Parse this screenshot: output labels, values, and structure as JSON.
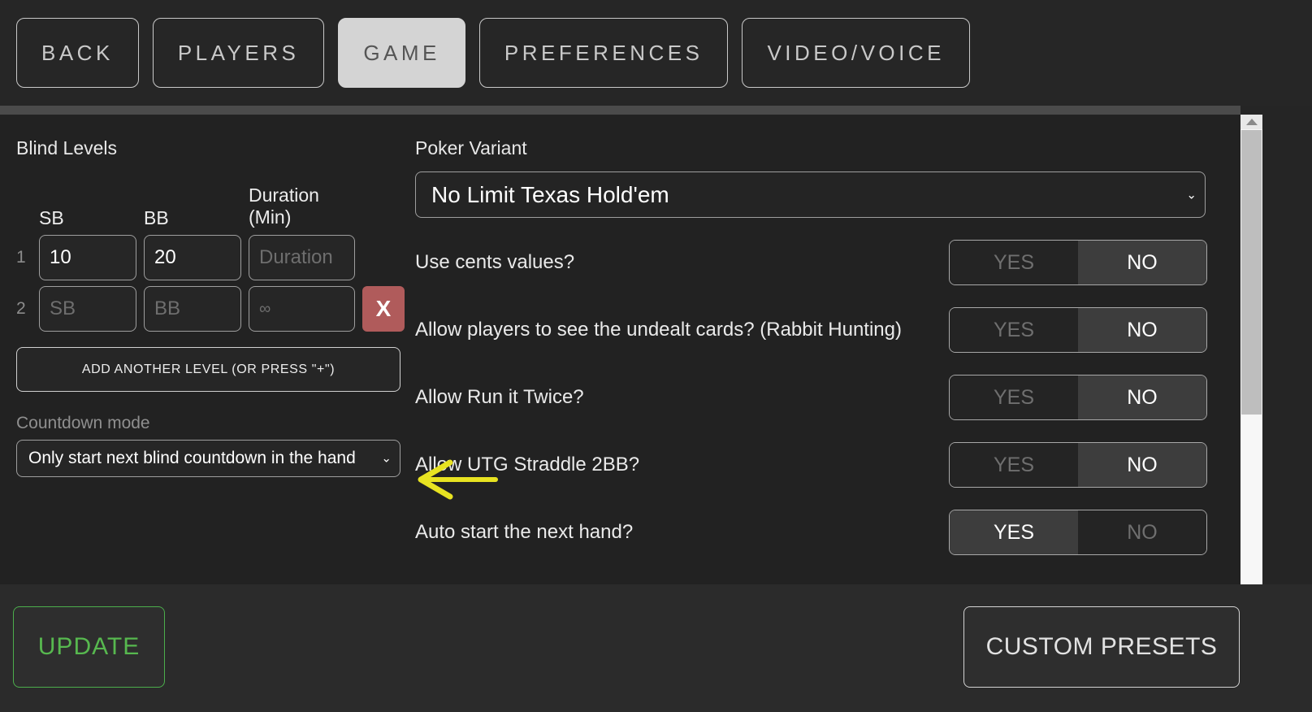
{
  "tabs": [
    {
      "label": "BACK",
      "active": false
    },
    {
      "label": "PLAYERS",
      "active": false
    },
    {
      "label": "GAME",
      "active": true
    },
    {
      "label": "PREFERENCES",
      "active": false
    },
    {
      "label": "VIDEO/VOICE",
      "active": false
    }
  ],
  "blind_levels": {
    "title": "Blind Levels",
    "columns": {
      "sb": "SB",
      "bb": "BB",
      "duration": "Duration (Min)"
    },
    "duration_line1": "Duration",
    "duration_line2": "(Min)",
    "rows": [
      {
        "num": "1",
        "sb_value": "10",
        "bb_value": "20",
        "sb_placeholder": "SB",
        "bb_placeholder": "BB",
        "duration_value": "",
        "duration_placeholder": "Duration",
        "delete_label": ""
      },
      {
        "num": "2",
        "sb_value": "",
        "bb_value": "",
        "sb_placeholder": "SB",
        "bb_placeholder": "BB",
        "duration_value": "",
        "duration_placeholder": "∞",
        "delete_label": "X"
      }
    ],
    "add_level_label": "ADD ANOTHER LEVEL (OR PRESS \"+\")",
    "countdown_label": "Countdown mode",
    "countdown_value": "Only start next blind countdown in the hand",
    "chevron": "⌄"
  },
  "game_settings": {
    "poker_variant_label": "Poker Variant",
    "poker_variant_value": "No Limit Texas Hold'em",
    "chevron": "⌄",
    "toggles": [
      {
        "label": "Use cents values?",
        "yes": "YES",
        "no": "NO",
        "selected": "NO"
      },
      {
        "label": "Allow players to see the undealt cards? (Rabbit Hunting)",
        "yes": "YES",
        "no": "NO",
        "selected": "NO"
      },
      {
        "label": "Allow Run it Twice?",
        "yes": "YES",
        "no": "NO",
        "selected": "NO"
      },
      {
        "label": "Allow UTG Straddle 2BB?",
        "yes": "YES",
        "no": "NO",
        "selected": "NO"
      },
      {
        "label": "Auto start the next hand?",
        "yes": "YES",
        "no": "NO",
        "selected": "YES"
      }
    ]
  },
  "footer": {
    "update_label": "UPDATE",
    "custom_presets_label": "CUSTOM PRESETS"
  },
  "annotation": {
    "arrow_color": "#e8e321",
    "direction": "left"
  },
  "colors": {
    "background": "#222222",
    "tab_active_bg": "#d4d4d4",
    "delete_red": "#b05b5b",
    "update_green": "#57b84f",
    "toggle_selected_bg": "#3d3d3d"
  }
}
